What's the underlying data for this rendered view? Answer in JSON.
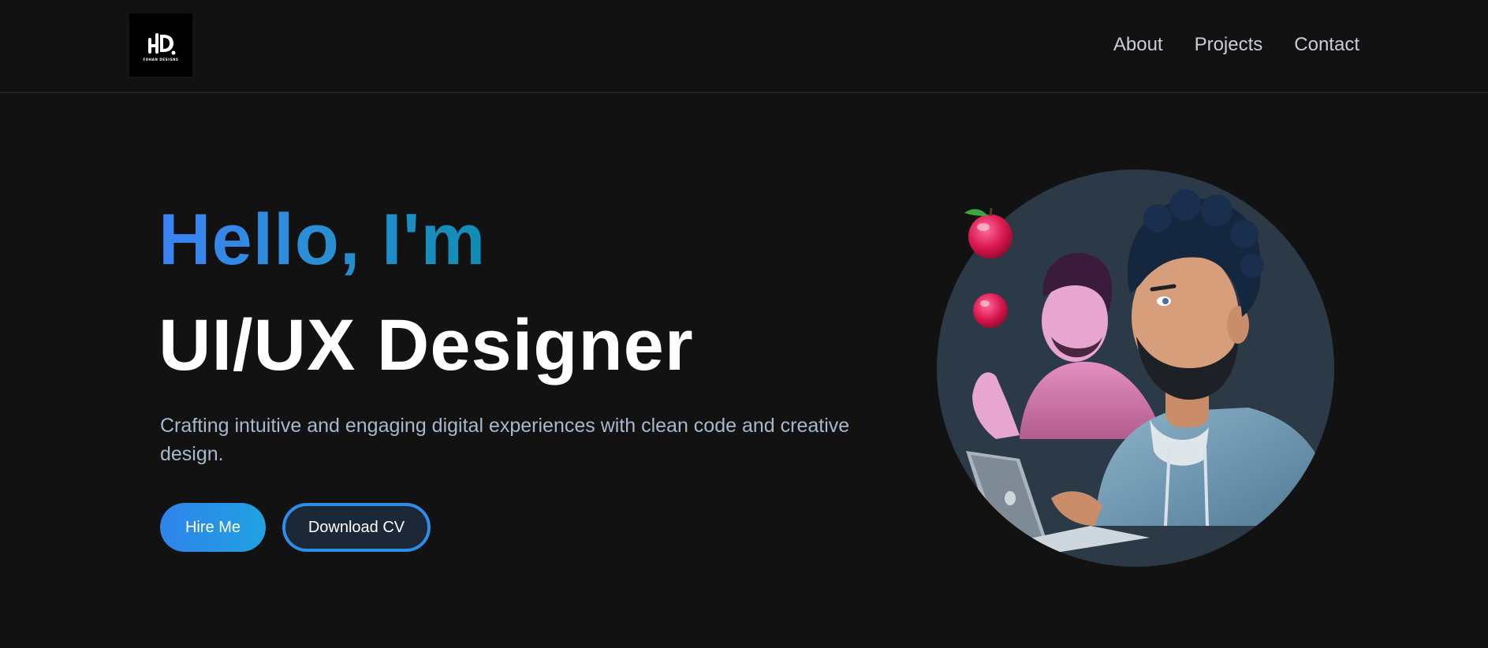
{
  "logo": {
    "subtitle": "FOHAN DESIGNS"
  },
  "nav": {
    "items": [
      "About",
      "Projects",
      "Contact"
    ]
  },
  "hero": {
    "greeting": "Hello, I'm",
    "role": "UI/UX Designer",
    "tagline": "Crafting intuitive and engaging digital experiences with clean code and creative design.",
    "primary_button": "Hire Me",
    "secondary_button": "Download CV"
  },
  "colors": {
    "background": "#121212",
    "accent_blue": "#3b82f6",
    "accent_teal": "#0f8db4",
    "tagline": "#a8b8cc",
    "illustration_circle": "#2b3a46"
  },
  "illustration": {
    "icon": "designer-avatar-illustration"
  }
}
